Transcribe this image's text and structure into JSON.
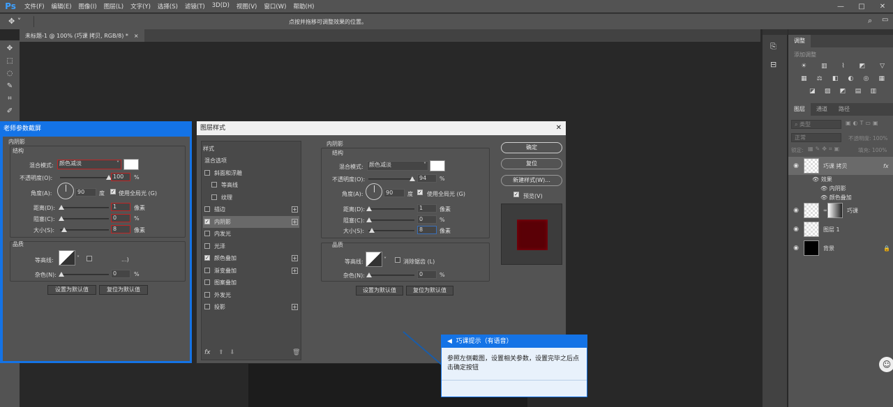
{
  "app": {
    "logo": "Ps"
  },
  "menu": [
    "文件(F)",
    "编辑(E)",
    "图像(I)",
    "图层(L)",
    "文字(Y)",
    "选择(S)",
    "滤镜(T)",
    "3D(D)",
    "视图(V)",
    "窗口(W)",
    "帮助(H)"
  ],
  "window_controls": {
    "minimize": "—",
    "maximize": "□",
    "close": "✕"
  },
  "options_bar": {
    "hint": "点按并拖移可调整效果的位置。",
    "tool_icon": "move-tool-icon"
  },
  "document_tab": {
    "title": "未标题-1 @ 100% (巧课 拷贝, RGB/8) *",
    "close": "×"
  },
  "teacher_panel": {
    "title": "老师参数截屏",
    "section": "内阴影",
    "structure_label": "结构",
    "blend_mode_label": "混合模式:",
    "blend_mode_value": "颜色减淡",
    "opacity_label": "不透明度(O):",
    "opacity_value": "100",
    "angle_label": "角度(A):",
    "angle_value": "90",
    "angle_unit": "度",
    "global_light": "使用全局光 (G)",
    "distance_label": "距离(D):",
    "distance_value": "1",
    "choke_label": "阻塞(C):",
    "choke_value": "0",
    "size_label": "大小(S):",
    "size_value": "8",
    "pixel_unit": "像素",
    "percent": "%",
    "quality_label": "品质",
    "contour_label": "等高线:",
    "antialias_label": "...)",
    "noise_label": "杂色(N):",
    "noise_value": "0",
    "set_default": "设置为默认值",
    "reset_default": "复位为默认值"
  },
  "layer_style_dialog": {
    "title": "图层样式",
    "close": "✕",
    "styles_header": "样式",
    "style_items": [
      {
        "label": "混合选项",
        "checkbox": false,
        "checked": false,
        "plus": false,
        "indent": false
      },
      {
        "label": "斜面和浮雕",
        "checkbox": true,
        "checked": false,
        "plus": false,
        "indent": false
      },
      {
        "label": "等高线",
        "checkbox": true,
        "checked": false,
        "plus": false,
        "indent": true
      },
      {
        "label": "纹理",
        "checkbox": true,
        "checked": false,
        "plus": false,
        "indent": true
      },
      {
        "label": "描边",
        "checkbox": true,
        "checked": false,
        "plus": true,
        "indent": false
      },
      {
        "label": "内阴影",
        "checkbox": true,
        "checked": true,
        "plus": true,
        "indent": false,
        "active": true
      },
      {
        "label": "内发光",
        "checkbox": true,
        "checked": false,
        "plus": false,
        "indent": false
      },
      {
        "label": "光泽",
        "checkbox": true,
        "checked": false,
        "plus": false,
        "indent": false
      },
      {
        "label": "颜色叠加",
        "checkbox": true,
        "checked": true,
        "plus": true,
        "indent": false
      },
      {
        "label": "渐变叠加",
        "checkbox": true,
        "checked": false,
        "plus": true,
        "indent": false
      },
      {
        "label": "图案叠加",
        "checkbox": true,
        "checked": false,
        "plus": false,
        "indent": false
      },
      {
        "label": "外发光",
        "checkbox": true,
        "checked": false,
        "plus": false,
        "indent": false
      },
      {
        "label": "投影",
        "checkbox": true,
        "checked": false,
        "plus": true,
        "indent": false
      }
    ],
    "fx_label": "fx",
    "section": "内阴影",
    "structure_label": "结构",
    "blend_mode_label": "混合模式:",
    "blend_mode_value": "颜色减淡",
    "opacity_label": "不透明度(O):",
    "opacity_value": "94",
    "angle_label": "角度(A):",
    "angle_value": "90",
    "angle_unit": "度",
    "global_light": "使用全局光 (G)",
    "distance_label": "距离(D):",
    "distance_value": "1",
    "choke_label": "阻塞(C):",
    "choke_value": "0",
    "size_label": "大小(S):",
    "size_value": "8",
    "pixel_unit": "像素",
    "percent": "%",
    "quality_label": "品质",
    "contour_label": "等高线:",
    "antialias": "消除锯齿 (L)",
    "noise_label": "杂色(N):",
    "noise_value": "0",
    "set_default": "设置为默认值",
    "reset_default": "复位为默认值",
    "ok": "确定",
    "reset": "复位",
    "new_style": "新建样式(W)...",
    "preview": "预览(V)",
    "preview_color": "#5a0006"
  },
  "hint_popup": {
    "title": "巧课提示（有语音）",
    "body": "参照左侧截图，设置相关参数，设置完毕之后点击确定按钮"
  },
  "right_panel": {
    "adjust_tab": "调整",
    "add_adjust": "添加调整",
    "layer_tabs": [
      "图层",
      "通道",
      "路径"
    ],
    "filter_kind": "类型",
    "blend_mode": "正常",
    "opacity_label": "不透明度:",
    "opacity_value": "100%",
    "lock_label": "锁定:",
    "fill_label": "填充:",
    "fill_value": "100%",
    "layers": [
      {
        "name": "巧课 拷贝",
        "thumb": "checker",
        "fx": "fx",
        "selected": true
      },
      {
        "name": "效果",
        "sub": true,
        "level": 1
      },
      {
        "name": "内阴影",
        "sub": true,
        "level": 2
      },
      {
        "name": "颜色叠加",
        "sub": true,
        "level": 2
      },
      {
        "name": "巧课",
        "thumb": "text",
        "mask": true
      },
      {
        "name": "图层 1",
        "thumb": "checker"
      },
      {
        "name": "背景",
        "thumb": "black",
        "lock": true
      }
    ]
  }
}
